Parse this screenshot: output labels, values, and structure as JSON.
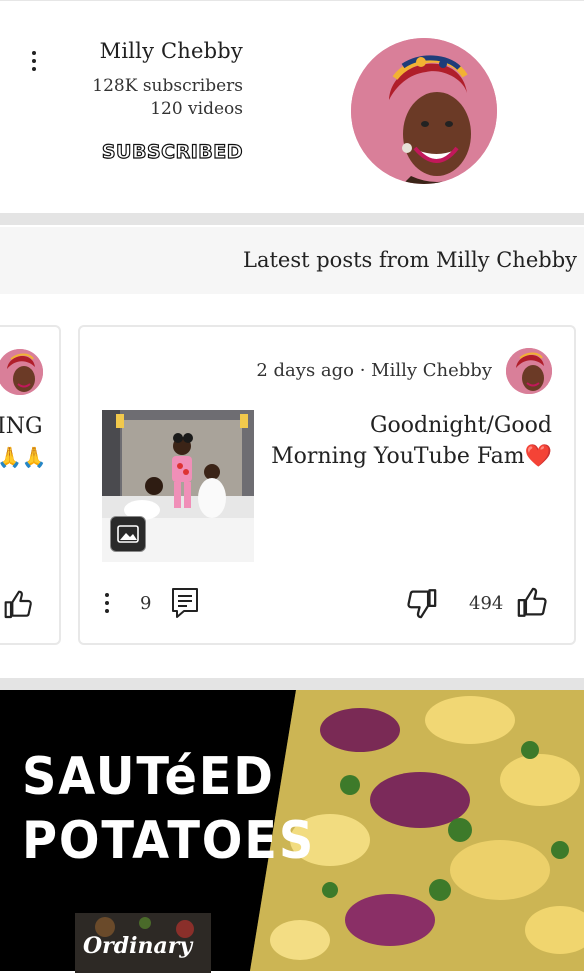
{
  "channel": {
    "name": "Milly Chebby",
    "subscribers": "128K subscribers",
    "videos": "120 videos",
    "subscribe_state": "SUBSCRIBED",
    "avatar_color": "#d97f99"
  },
  "posts_section": {
    "title": "Latest posts from Milly Chebby"
  },
  "prev_card": {
    "text_line1": "ING",
    "text_line2": "🙏🙏"
  },
  "post": {
    "meta": "2 days ago · Milly Chebby",
    "text": "Goodnight/Good Morning YouTube Fam❤️",
    "comment_count": "9",
    "like_count": "494",
    "image_icon": "image-icon"
  },
  "video_thumbnail": {
    "title": "SAUTéED\nPOTATOES",
    "brand_text": "Ordinary"
  },
  "icons": [
    "more-vert-icon",
    "comment-icon",
    "thumbs-up-icon",
    "thumbs-down-icon",
    "image-icon"
  ]
}
